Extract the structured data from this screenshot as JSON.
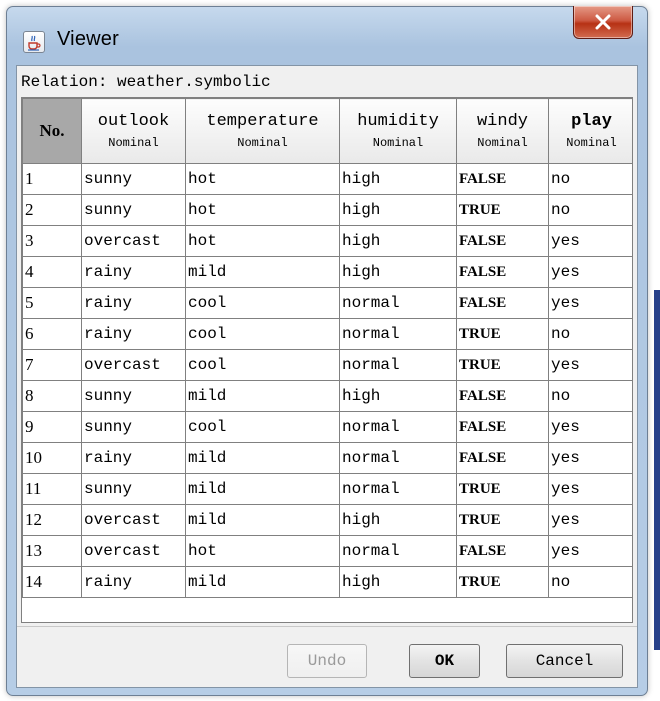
{
  "window": {
    "title": "Viewer",
    "app_icon": "java-cup-icon",
    "close_icon": "close-x-icon"
  },
  "relation": {
    "label": "Relation: weather.symbolic"
  },
  "table": {
    "no_header": "No.",
    "columns": [
      {
        "name": "outlook",
        "type": "Nominal"
      },
      {
        "name": "temperature",
        "type": "Nominal"
      },
      {
        "name": "humidity",
        "type": "Nominal"
      },
      {
        "name": "windy",
        "type": "Nominal"
      },
      {
        "name": "play",
        "type": "Nominal"
      }
    ],
    "rows": [
      {
        "no": "1",
        "outlook": "sunny",
        "temperature": "hot",
        "humidity": "high",
        "windy": "FALSE",
        "play": "no"
      },
      {
        "no": "2",
        "outlook": "sunny",
        "temperature": "hot",
        "humidity": "high",
        "windy": "TRUE",
        "play": "no"
      },
      {
        "no": "3",
        "outlook": "overcast",
        "temperature": "hot",
        "humidity": "high",
        "windy": "FALSE",
        "play": "yes"
      },
      {
        "no": "4",
        "outlook": "rainy",
        "temperature": "mild",
        "humidity": "high",
        "windy": "FALSE",
        "play": "yes"
      },
      {
        "no": "5",
        "outlook": "rainy",
        "temperature": "cool",
        "humidity": "normal",
        "windy": "FALSE",
        "play": "yes"
      },
      {
        "no": "6",
        "outlook": "rainy",
        "temperature": "cool",
        "humidity": "normal",
        "windy": "TRUE",
        "play": "no"
      },
      {
        "no": "7",
        "outlook": "overcast",
        "temperature": "cool",
        "humidity": "normal",
        "windy": "TRUE",
        "play": "yes"
      },
      {
        "no": "8",
        "outlook": "sunny",
        "temperature": "mild",
        "humidity": "high",
        "windy": "FALSE",
        "play": "no"
      },
      {
        "no": "9",
        "outlook": "sunny",
        "temperature": "cool",
        "humidity": "normal",
        "windy": "FALSE",
        "play": "yes"
      },
      {
        "no": "10",
        "outlook": "rainy",
        "temperature": "mild",
        "humidity": "normal",
        "windy": "FALSE",
        "play": "yes"
      },
      {
        "no": "11",
        "outlook": "sunny",
        "temperature": "mild",
        "humidity": "normal",
        "windy": "TRUE",
        "play": "yes"
      },
      {
        "no": "12",
        "outlook": "overcast",
        "temperature": "mild",
        "humidity": "high",
        "windy": "TRUE",
        "play": "yes"
      },
      {
        "no": "13",
        "outlook": "overcast",
        "temperature": "hot",
        "humidity": "normal",
        "windy": "FALSE",
        "play": "yes"
      },
      {
        "no": "14",
        "outlook": "rainy",
        "temperature": "mild",
        "humidity": "high",
        "windy": "TRUE",
        "play": "no"
      }
    ]
  },
  "buttons": {
    "undo": "Undo",
    "ok": "OK",
    "cancel": "Cancel"
  }
}
